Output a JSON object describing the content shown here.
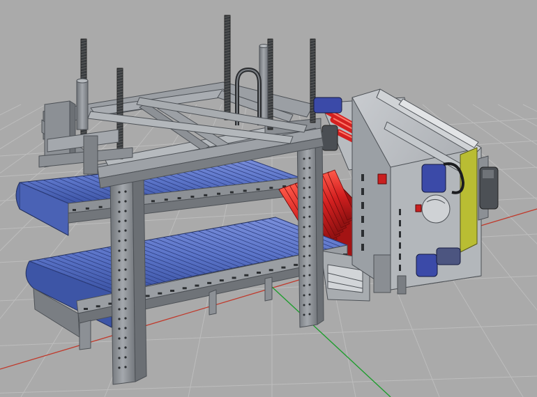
{
  "viewport": {
    "background_color": "#aaaaaa",
    "grid_color": "#bcbcbc",
    "x_axis_color": "#c0392b",
    "y_axis_color": "#1f9d2e",
    "frame_color": "#8d9196",
    "frame_dark": "#4d5156",
    "belt_color": "#5b74c8",
    "red_roller_color": "#d42020",
    "panel_color": "#bfc2c6",
    "motor_color": "#3b4aa8",
    "accent_yellow": "#b9bd33"
  }
}
